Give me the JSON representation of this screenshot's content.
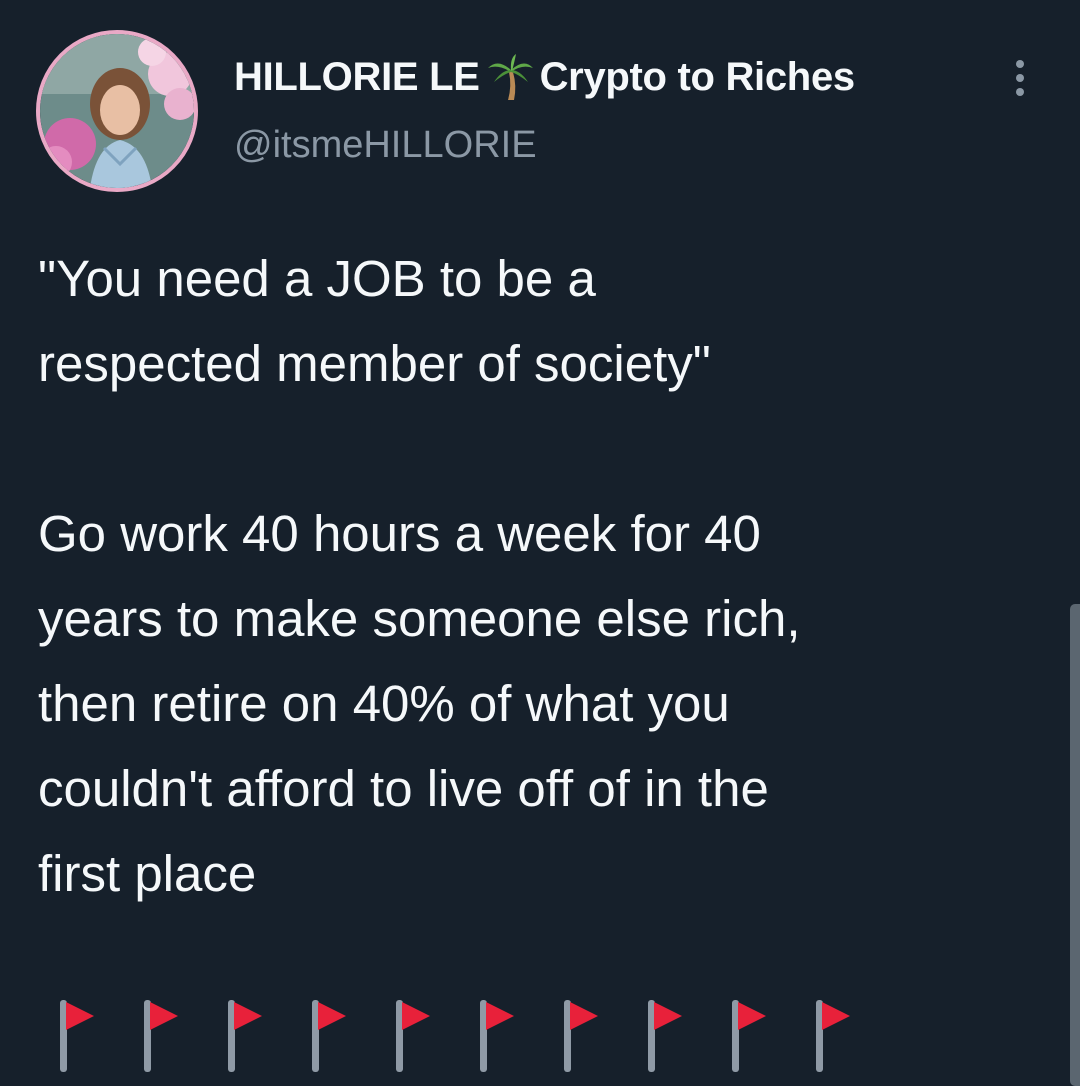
{
  "author": {
    "display_name": "HILLORIE LE",
    "name_emoji": "palm-tree-icon",
    "name_suffix": "Crypto to Riches",
    "handle": "@itsmeHILLORIE"
  },
  "tweet": {
    "text": "\"You need a JOB to be a\nrespected member of society\"\n\nGo work 40 hours a week for 40\nyears to make someone else rich,\nthen retire on 40% of what you\ncouldn't afford to live off of in the\nfirst place",
    "emoji_row": {
      "icon": "red-flag-icon",
      "count": 10
    }
  },
  "colors": {
    "background": "#16202b",
    "text": "#f5f8fa",
    "secondary_text": "#8b98a5",
    "flag_red": "#e8213a",
    "avatar_ring": "#e9a9c6"
  },
  "icons": {
    "more": "more-vertical-icon",
    "avatar": "avatar"
  }
}
